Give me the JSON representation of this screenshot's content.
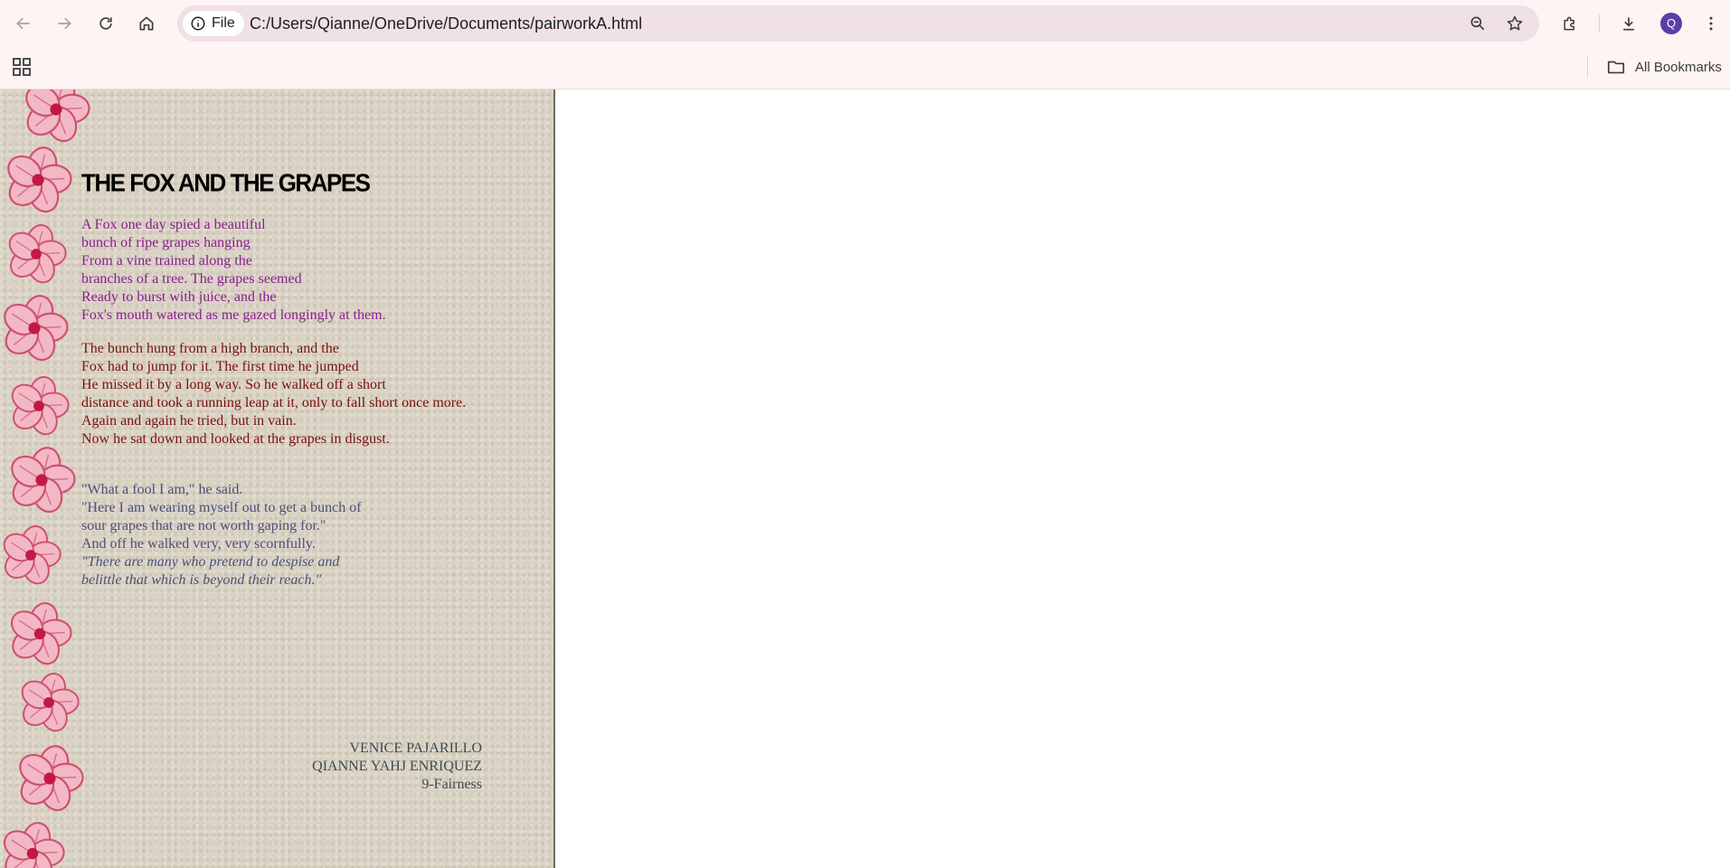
{
  "browser": {
    "url_chip_label": "File",
    "url": "C:/Users/Qianne/OneDrive/Documents/pairworkA.html",
    "profile_initial": "Q",
    "all_bookmarks_label": "All Bookmarks",
    "icons": [
      "back-icon",
      "forward-icon",
      "reload-icon",
      "home-icon",
      "info-icon",
      "zoom-icon",
      "star-icon",
      "extensions-icon",
      "download-icon",
      "menu-icon",
      "apps-icon",
      "folder-icon"
    ]
  },
  "story": {
    "title": "THE FOX AND THE GRAPES",
    "paragraph1": [
      "A Fox one day spied a beautiful",
      "bunch of ripe grapes hanging",
      "From a vine trained along the",
      "branches of a tree. The grapes seemed",
      "Ready to burst with juice, and the",
      "Fox's mouth watered as me gazed longingly at them."
    ],
    "paragraph2": [
      "The bunch hung from a high branch, and the",
      "Fox had to jump for it. The first time he jumped",
      "He missed it by a long way. So he walked off a short",
      "distance and took a running leap at it, only to fall short once more.",
      "Again and again he tried, but in vain.",
      "Now he sat down and looked at the grapes in disgust."
    ],
    "paragraph3": [
      "\"What a fool I am,\" he said.",
      "\"Here I am wearing myself out to get a bunch of",
      "sour grapes that are not worth gaping for.\"",
      "And off he walked very, very scornfully."
    ],
    "moral": [
      "\"There are many who pretend to despise and",
      "belittle that which is beyond their reach.\""
    ],
    "credits": [
      "VENICE PAJARILLO",
      "QIANNE YAHJ ENRIQUEZ",
      "9-Fairness"
    ]
  },
  "colors": {
    "paragraph1": "#8a1f8f",
    "paragraph2": "#7a1010",
    "paragraph3": "#4d4f7a",
    "flower": "#d0506f",
    "page_background": "#d9d2c3"
  }
}
